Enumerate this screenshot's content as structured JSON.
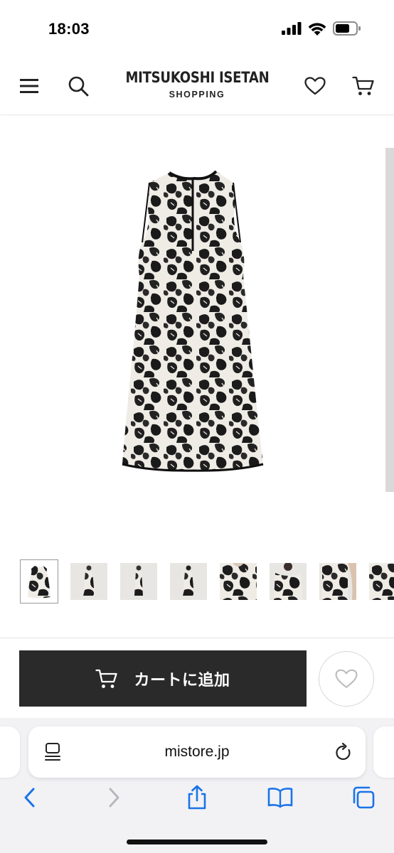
{
  "status_bar": {
    "time": "18:03"
  },
  "header": {
    "brand_name": "MITSUKOSHI ISETAN",
    "brand_sub": "SHOPPING",
    "icons": [
      "menu-icon",
      "search-icon",
      "heart-icon",
      "cart-icon"
    ]
  },
  "gallery": {
    "main_image": "floral-print-sleeveless-dress",
    "thumbnail_count": 8,
    "active_thumbnail": 1
  },
  "actions": {
    "add_to_cart_label": "カートに追加",
    "favorite_icon": "heart-icon"
  },
  "browser": {
    "url": "mistore.jp",
    "toolbar_icons": [
      "back-icon",
      "forward-icon",
      "share-icon",
      "bookmarks-icon",
      "tabs-icon"
    ]
  },
  "colors": {
    "cart_button_bg": "#2a2a2a",
    "ios_blue": "#1a73e8",
    "browser_bg": "#f2f2f5"
  }
}
